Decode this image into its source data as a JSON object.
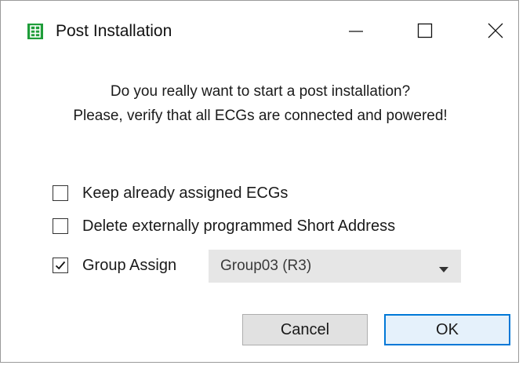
{
  "window": {
    "title": "Post Installation",
    "controls": {
      "minimize": "minimize-icon",
      "maximize": "maximize-icon",
      "close": "close-icon"
    },
    "app_icon": "grid-app-icon",
    "app_icon_color": "#1f9d3a"
  },
  "message": {
    "line1": "Do you really want to start a post installation?",
    "line2": "Please, verify that all ECGs are connected and powered!"
  },
  "options": [
    {
      "label": "Keep already assigned ECGs",
      "checked": false
    },
    {
      "label": "Delete externally programmed Short Address",
      "checked": false
    },
    {
      "label": "Group Assign",
      "checked": true
    }
  ],
  "group_select": {
    "selected": "Group03 (R3)"
  },
  "buttons": {
    "cancel": "Cancel",
    "ok": "OK"
  },
  "colors": {
    "accent": "#0078d7",
    "ok_background": "#e5f1fb",
    "combo_background": "#e6e6e6"
  }
}
